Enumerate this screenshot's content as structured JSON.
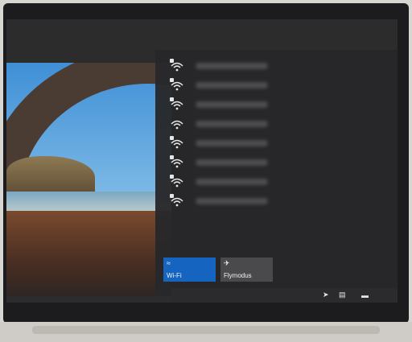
{
  "networks": [
    {
      "secured": true
    },
    {
      "secured": true
    },
    {
      "secured": true
    },
    {
      "secured": false
    },
    {
      "secured": true
    },
    {
      "secured": true
    },
    {
      "secured": true
    },
    {
      "secured": true
    }
  ],
  "quick_actions": {
    "wifi_label": "Wi-Fi",
    "airplane_label": "Flymodus"
  },
  "colors": {
    "wifi_tile": "#1565c0",
    "airplane_tile": "#4a4a4c"
  }
}
